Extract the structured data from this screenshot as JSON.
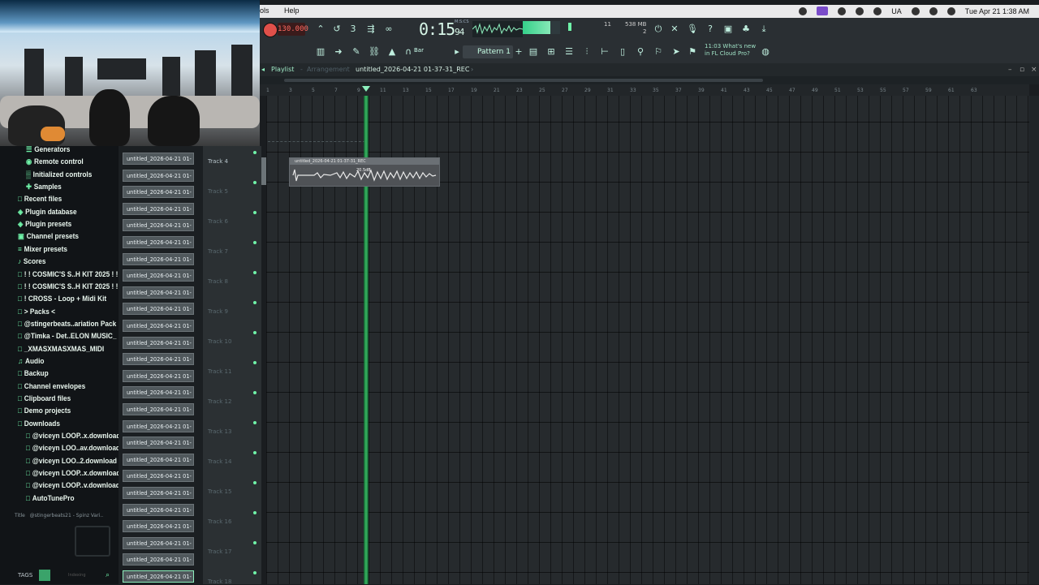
{
  "menubar": {
    "left": [
      "ols",
      "Help"
    ],
    "clock": "Tue Apr 21  1:38 AM",
    "lang": "UA"
  },
  "toolbar": {
    "tempo": "130.000",
    "time": "0:15",
    "time_frac": "94",
    "time_unit": "M:S:CS",
    "memory": "538 MB",
    "poly": "2",
    "cpu": "11",
    "pattern": "Pattern 1",
    "snap": "Bar",
    "whats_new_time": "11:03",
    "whats_new_1": "What's new",
    "whats_new_2": "in FL Cloud Pro?"
  },
  "playlist": {
    "title": "Playlist",
    "sep": "-",
    "mode": "Arrangement",
    "project": "untitled_2026-04-21 01-37-31_REC",
    "ruler": [
      "1",
      "3",
      "5",
      "7",
      "9",
      "11",
      "13",
      "15",
      "17",
      "19",
      "21",
      "23",
      "25",
      "27",
      "29",
      "31",
      "33",
      "35",
      "37",
      "39",
      "41",
      "43",
      "45",
      "47",
      "49",
      "51",
      "53",
      "55",
      "57",
      "59",
      "61",
      "63"
    ],
    "clip_name": "untitled_2026-04-21 01-37-31_REC",
    "clip_vol": "20.5dB",
    "tracks": [
      "Track 4",
      "Track 5",
      "Track 6",
      "Track 7",
      "Track 8",
      "Track 9",
      "Track 10",
      "Track 11",
      "Track 12",
      "Track 13",
      "Track 14",
      "Track 15",
      "Track 16",
      "Track 17",
      "Track 18"
    ]
  },
  "browser": {
    "items": [
      {
        "label": "Generators",
        "glyph": "☰",
        "indent": 2
      },
      {
        "label": "Remote control",
        "glyph": "◉",
        "indent": 2
      },
      {
        "label": "Initialized controls",
        "glyph": "▒",
        "indent": 2
      },
      {
        "label": "Samples",
        "glyph": "✚",
        "indent": 2
      },
      {
        "label": "Recent files",
        "glyph": "□",
        "indent": 1
      },
      {
        "label": "Plugin database",
        "glyph": "◈",
        "indent": 1
      },
      {
        "label": "Plugin presets",
        "glyph": "◈",
        "indent": 1
      },
      {
        "label": "Channel presets",
        "glyph": "▣",
        "indent": 1
      },
      {
        "label": "Mixer presets",
        "glyph": "≡",
        "indent": 1
      },
      {
        "label": "Scores",
        "glyph": "♪",
        "indent": 1
      },
      {
        "label": "! ! COSMIC'S S..H KIT 2025 ! !",
        "glyph": "□",
        "indent": 1
      },
      {
        "label": "! ! COSMIC'S S..H KIT 2025 ! !",
        "glyph": "□",
        "indent": 1
      },
      {
        "label": "! CROSS - Loop + Midi Kit",
        "glyph": "□",
        "indent": 1
      },
      {
        "label": "> Packs <",
        "glyph": "□",
        "indent": 1
      },
      {
        "label": "@stingerbeats..ariation Pack",
        "glyph": "□",
        "indent": 1
      },
      {
        "label": "@Timka - Det..ELON MUSIC_",
        "glyph": "□",
        "indent": 1
      },
      {
        "label": "_XMASXMASXMAS_MIDI",
        "glyph": "□",
        "indent": 1
      },
      {
        "label": "Audio",
        "glyph": "♫",
        "indent": 1
      },
      {
        "label": "Backup",
        "glyph": "□",
        "indent": 1
      },
      {
        "label": "Channel envelopes",
        "glyph": "□",
        "indent": 1
      },
      {
        "label": "Clipboard files",
        "glyph": "□",
        "indent": 1
      },
      {
        "label": "Demo projects",
        "glyph": "□",
        "indent": 1
      },
      {
        "label": "Downloads",
        "glyph": "□",
        "indent": 1
      },
      {
        "label": "@viceyn LOOP..x.download",
        "glyph": "□",
        "indent": 2
      },
      {
        "label": "@viceyn LOO..av.download",
        "glyph": "□",
        "indent": 2
      },
      {
        "label": "@viceyn LOO..2.download",
        "glyph": "□",
        "indent": 2
      },
      {
        "label": "@viceyn LOOP..x.download",
        "glyph": "□",
        "indent": 2
      },
      {
        "label": "@viceyn LOOP..v.download",
        "glyph": "□",
        "indent": 2
      },
      {
        "label": "AutoTunePro",
        "glyph": "□",
        "indent": 2
      }
    ],
    "footer_key": "Title",
    "footer_val": "@stingerbeats21 - Spinz Vari..",
    "tags_label": "TAGS",
    "indexing": "Indexing"
  },
  "recent": {
    "item_label": "untitled_2026-04-21 01-",
    "count": 26
  },
  "colors": {
    "accent": "#6ff2a8",
    "record": "#e0504a",
    "playhead": "#3bd36d"
  }
}
